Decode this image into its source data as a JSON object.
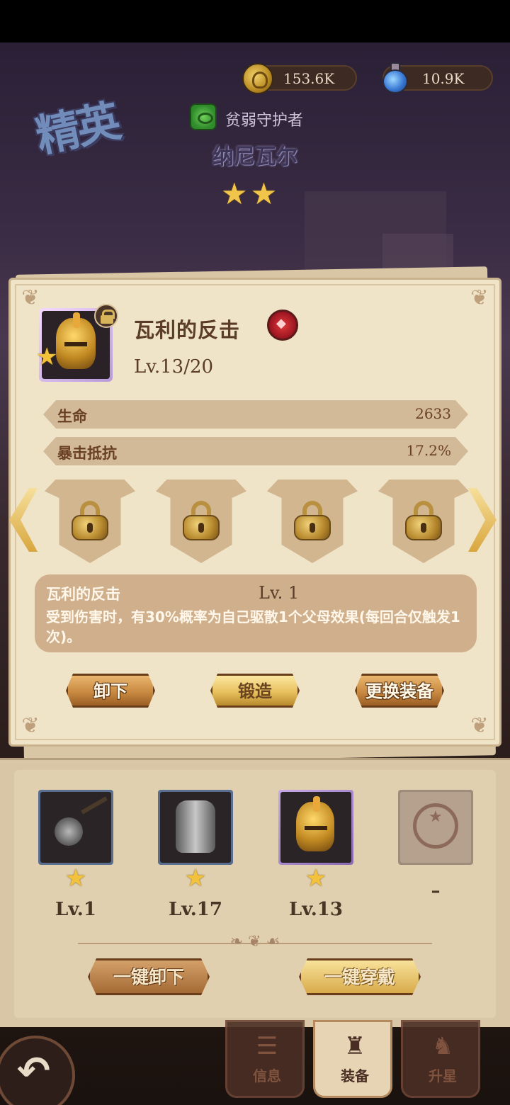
{
  "currency": {
    "gold": "153.6K",
    "potion": "10.9K"
  },
  "hero": {
    "rank_label": "精英",
    "faction": "贫弱守护者",
    "name": "纳尼瓦尔",
    "stars": "★★"
  },
  "item": {
    "name": "瓦利的反击",
    "level": "Lv.13/20",
    "star": "★",
    "stats": [
      {
        "label": "生命",
        "value": "2633"
      },
      {
        "label": "暴击抵抗",
        "value": "17.2%"
      }
    ],
    "slot_icon": "padlock-icon",
    "skill": {
      "name": "瓦利的反击",
      "level": "Lv. 1",
      "description": "受到伤害时，有30%概率为自己驱散1个父母效果(每回合仅触发1次)。"
    },
    "buttons": {
      "unequip": "卸下",
      "forge": "锻造",
      "replace": "更换装备"
    }
  },
  "equipment": [
    {
      "icon": "mace-icon",
      "star": "★",
      "level": "Lv.1"
    },
    {
      "icon": "armor-icon",
      "star": "★",
      "level": "Lv.17"
    },
    {
      "icon": "helmet-icon",
      "star": "★",
      "level": "Lv.13"
    },
    {
      "icon": "empty-slot-icon",
      "star": "",
      "level": "–"
    }
  ],
  "actions": {
    "unequip_all": "一键卸下",
    "equip_all": "一键穿戴"
  },
  "tabs": [
    {
      "label": "信息",
      "icon": "info-icon"
    },
    {
      "label": "装备",
      "icon": "equipment-icon"
    },
    {
      "label": "升星",
      "icon": "star-up-icon"
    }
  ],
  "colors": {
    "parchment": "#efe3c8",
    "stat_bar": "#d2b998",
    "gold_button": "#e8c05e",
    "brown_button": "#c98a42",
    "star": "#f3c23c"
  }
}
